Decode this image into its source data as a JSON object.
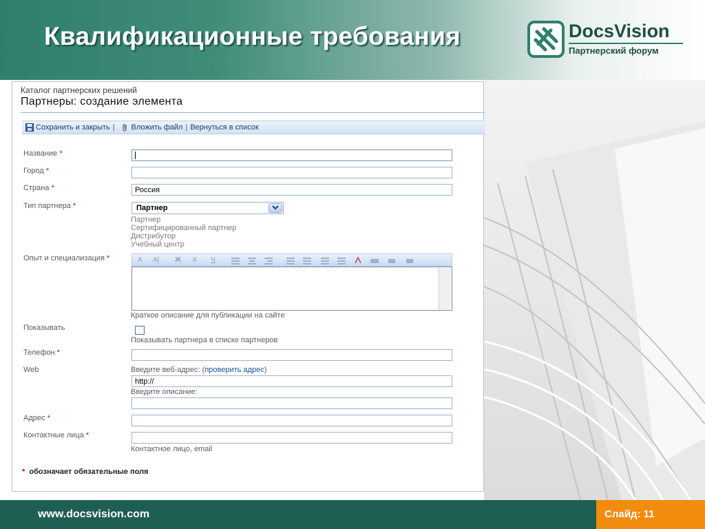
{
  "slide": {
    "title": "Квалификационные требования",
    "logo_name": "DocsVision",
    "logo_subtitle": "Партнерский форум",
    "footer_url": "www.docsvision.com",
    "slide_number": "Слайд: 11"
  },
  "screenshot": {
    "breadcrumb": "Каталог партнерских решений",
    "page_title": "Партнеры: создание элемента",
    "toolbar": {
      "save_close": "Сохранить и закрыть",
      "attach_file": "Вложить файл",
      "back_to_list": "Вернуться в список"
    },
    "fields": {
      "name_label": "Название",
      "city_label": "Город",
      "country_label": "Страна",
      "country_value": "Россия",
      "partner_type_label": "Тип партнера",
      "partner_type_value": "Партнер",
      "partner_type_options": [
        "Партнер",
        "Сертифицированный партнер",
        "Дистрибутор",
        "Учебный центр"
      ],
      "experience_label": "Опыт и специализация",
      "experience_hint": "Краткое описание для публикации на сайте",
      "show_label": "Показывать",
      "show_hint": "Показывать партнера в списке партнеров",
      "phone_label": "Телефон",
      "web_label": "Web",
      "web_hint_prefix": "Введите веб-адрес: (",
      "web_hint_link": "проверить адрес",
      "web_hint_suffix": ")",
      "web_value": "http://",
      "web_desc_hint": "Введите описание:",
      "address_label": "Адрес",
      "contacts_label": "Контактные лица",
      "contacts_hint": "Контактное лицо, email"
    },
    "required_mark": "*",
    "required_note": "обозначает обязательные поля",
    "rte_buttons": [
      "A",
      "A|",
      "Ж",
      "К",
      "Ч"
    ]
  },
  "colors": {
    "brand_green": "#2f7f6c",
    "footer_green": "#1f5e53",
    "footer_orange": "#f28c0f",
    "required_red": "#d40000"
  }
}
